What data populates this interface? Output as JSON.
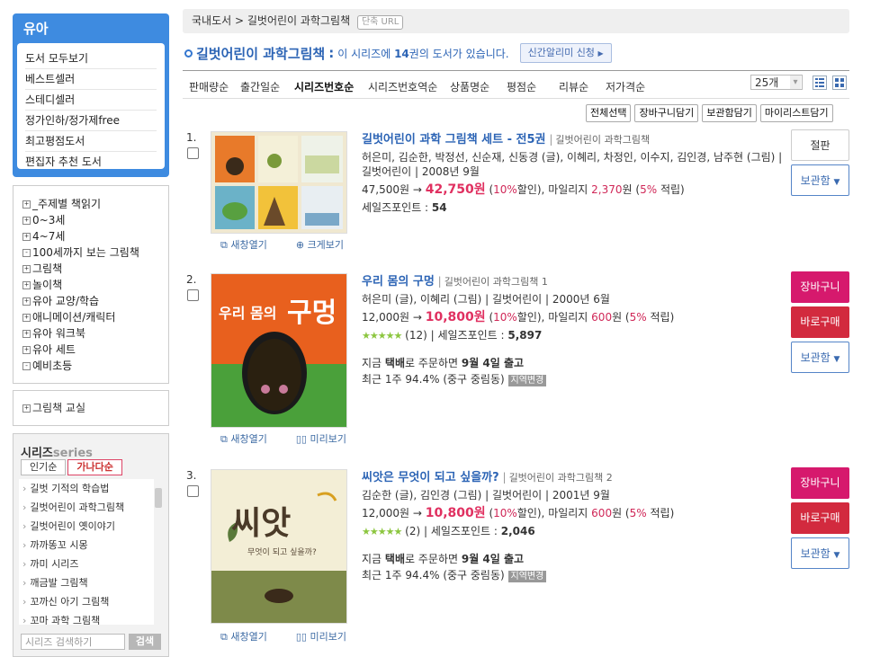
{
  "sidebar": {
    "category_title": "유아",
    "category_links": [
      "도서 모두보기",
      "베스트셀러",
      "스테디셀러",
      "정가인하/정가제free",
      "최고평점도서",
      "편집자 추천 도서"
    ],
    "tree": [
      "_주제별 책읽기",
      "0~3세",
      "4~7세",
      "100세까지 보는 그림책",
      "그림책",
      "놀이책",
      "유아 교양/학습",
      "애니메이션/캐릭터",
      "유아 워크북",
      "유아 세트",
      "예비초등"
    ],
    "tree2": [
      "그림책 교실"
    ],
    "series_title": "시리즈",
    "series_title_en": "series",
    "series_tabs": [
      "인기순",
      "가나다순"
    ],
    "series_list": [
      "길벗 기적의 학습법",
      "길벗어린이 과학그림책",
      "길벗어린이 옛이야기",
      "까까똥꼬 시몽",
      "까미 시리즈",
      "깨금발 그림책",
      "꼬까신 아기 그림책",
      "꼬마 과학 그림책"
    ],
    "series_search_placeholder": "시리즈 검색하기",
    "series_search_button": "검색"
  },
  "breadcrumb": {
    "root": "국내도서",
    "sep": ">",
    "current": "길벗어린이 과학그림책",
    "short_url": "단축 URL"
  },
  "header": {
    "title": "길벗어린이 과학그림책",
    "colon": ":",
    "count_pre": "이 시리즈에",
    "count": "14",
    "count_post": "권의 도서가 있습니다.",
    "alert_button": "신간알리미 신청"
  },
  "sort_options": [
    "판매량순",
    "출간일순",
    "시리즈번호순",
    "시리즈번호역순",
    "상품명순",
    "평점순",
    "리뷰순",
    "저가격순"
  ],
  "per_page": "25개",
  "actions": [
    "전체선택",
    "장바구니담기",
    "보관함담기",
    "마이리스트담기"
  ],
  "items": [
    {
      "num": "1.",
      "title": "길벗어린이 과학 그림책 세트 - 전5권",
      "series": "길벗어린이 과학그림책",
      "authors": "허은미, 김순한, 박정선, 신순재, 신동경 (글), 이혜리, 차정인, 이수지, 김인경, 남주현 (그림) |",
      "publisher": "길벗어린이 | 2008년 9월",
      "list_price": "47,500원",
      "sale_price": "42,750원",
      "discount": "10%",
      "mileage": "2,370",
      "mileage_rate": "5%",
      "salespoint": "54",
      "link_new": "새창열기",
      "link_view": "크게보기",
      "buttons": [
        "절판",
        "보관함"
      ]
    },
    {
      "num": "2.",
      "title": "우리 몸의 구멍",
      "series": "길벗어린이 과학그림책 1",
      "authors": "허은미 (글), 이혜리 (그림) | 길벗어린이 | 2000년 6월",
      "list_price": "12,000원",
      "sale_price": "10,800원",
      "discount": "10%",
      "mileage": "600",
      "mileage_rate": "5%",
      "reviews": "(12)",
      "salespoint": "5,897",
      "delivery_pre": "지금",
      "delivery_method": "택배",
      "delivery_mid": "로 주문하면",
      "delivery_date": "9월 4일 출고",
      "recent": "최근 1주 94.4% (중구 중림동)",
      "region": "지역변경",
      "link_new": "새창열기",
      "link_view": "미리보기",
      "cover_text_small": "우리 몸의",
      "cover_text_big": "구멍",
      "buttons": [
        "장바구니",
        "바로구매",
        "보관함"
      ]
    },
    {
      "num": "3.",
      "title": "씨앗은 무엇이 되고 싶을까?",
      "series": "길벗어린이 과학그림책 2",
      "authors": "김순한 (글), 김인경 (그림) | 길벗어린이 | 2001년 9월",
      "list_price": "12,000원",
      "sale_price": "10,800원",
      "discount": "10%",
      "mileage": "600",
      "mileage_rate": "5%",
      "reviews": "(2)",
      "salespoint": "2,046",
      "delivery_pre": "지금",
      "delivery_method": "택배",
      "delivery_mid": "로 주문하면",
      "delivery_date": "9월 4일 출고",
      "recent": "최근 1주 94.4% (중구 중림동)",
      "region": "지역변경",
      "link_new": "새창열기",
      "link_view": "미리보기",
      "cover_text_big": "씨앗",
      "cover_text_small": "무엇이 되고 싶을까?",
      "buttons": [
        "장바구니",
        "바로구매",
        "보관함"
      ]
    }
  ],
  "colors": {
    "accent_blue": "#2c64b5",
    "sidebar_blue": "#3e8be0",
    "price_pink": "#e03060",
    "cart_magenta": "#d6196d",
    "buy_red": "#d22a3e"
  }
}
